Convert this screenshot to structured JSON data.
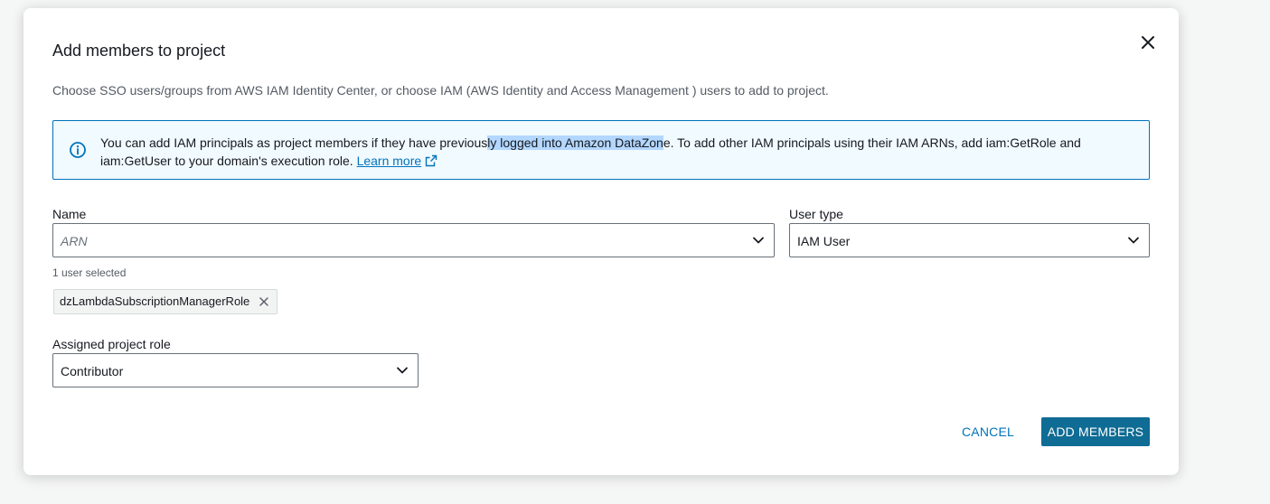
{
  "dialog": {
    "title": "Add members to project",
    "description": "Choose SSO users/groups from AWS IAM Identity Center, or choose IAM (AWS Identity and Access Management ) users to add to project."
  },
  "info": {
    "text_before": "You can add IAM principals as project members if they have previous",
    "text_highlight": "ly logged into Amazon DataZon",
    "text_after": "e. To add other IAM principals using their IAM ARNs, add iam:GetRole and iam:GetUser to your domain's execution role. ",
    "link": "Learn more"
  },
  "name_field": {
    "label": "Name",
    "placeholder": "ARN",
    "selection_count": "1 user selected",
    "tokens": [
      "dzLambdaSubscriptionManagerRole"
    ]
  },
  "user_type_field": {
    "label": "User type",
    "value": "IAM User"
  },
  "role_field": {
    "label": "Assigned project role",
    "value": "Contributor"
  },
  "actions": {
    "cancel": "CANCEL",
    "submit": "ADD MEMBERS"
  },
  "colors": {
    "primary": "#0f6c94",
    "link": "#0073bb",
    "info_bg": "#f1faff"
  }
}
